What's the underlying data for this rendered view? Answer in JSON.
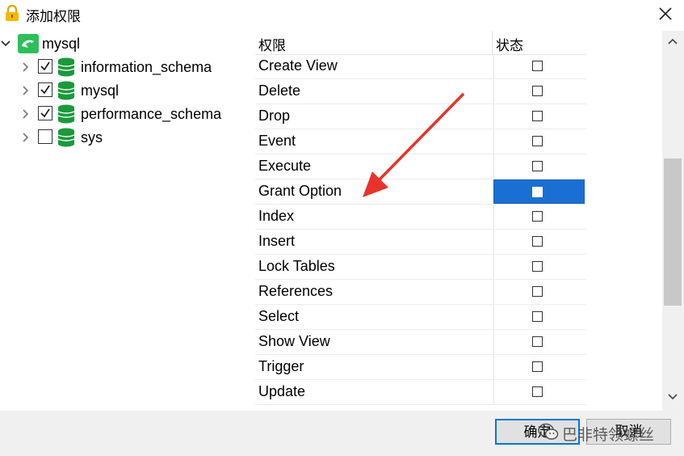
{
  "window": {
    "title": "添加权限",
    "title_icon": "lock-icon",
    "close_icon": "close-icon"
  },
  "tree": {
    "root": {
      "label": "mysql",
      "icon": "dolphin-icon",
      "expanded": true
    },
    "items": [
      {
        "label": "information_schema",
        "checked": true,
        "icon": "database-icon"
      },
      {
        "label": "mysql",
        "checked": true,
        "icon": "database-icon"
      },
      {
        "label": "performance_schema",
        "checked": true,
        "icon": "database-icon"
      },
      {
        "label": "sys",
        "checked": false,
        "icon": "database-icon"
      }
    ]
  },
  "grid": {
    "columns": [
      "权限",
      "状态"
    ],
    "rows": [
      {
        "name": "Create View",
        "checked": false,
        "selected": false
      },
      {
        "name": "Delete",
        "checked": false,
        "selected": false
      },
      {
        "name": "Drop",
        "checked": false,
        "selected": false
      },
      {
        "name": "Event",
        "checked": false,
        "selected": false
      },
      {
        "name": "Execute",
        "checked": false,
        "selected": false
      },
      {
        "name": "Grant Option",
        "checked": true,
        "selected": true
      },
      {
        "name": "Index",
        "checked": false,
        "selected": false
      },
      {
        "name": "Insert",
        "checked": false,
        "selected": false
      },
      {
        "name": "Lock Tables",
        "checked": false,
        "selected": false
      },
      {
        "name": "References",
        "checked": false,
        "selected": false
      },
      {
        "name": "Select",
        "checked": false,
        "selected": false
      },
      {
        "name": "Show View",
        "checked": false,
        "selected": false
      },
      {
        "name": "Trigger",
        "checked": false,
        "selected": false
      },
      {
        "name": "Update",
        "checked": false,
        "selected": false
      }
    ]
  },
  "buttons": {
    "ok": "确定",
    "cancel": "取消"
  },
  "watermark": {
    "text": "巴非特领螺丝",
    "icon": "wechat-icon"
  },
  "colors": {
    "selection": "#1a6fd4",
    "annotation_arrow": "#e8322a",
    "db_icon": "#1a9a3c"
  }
}
